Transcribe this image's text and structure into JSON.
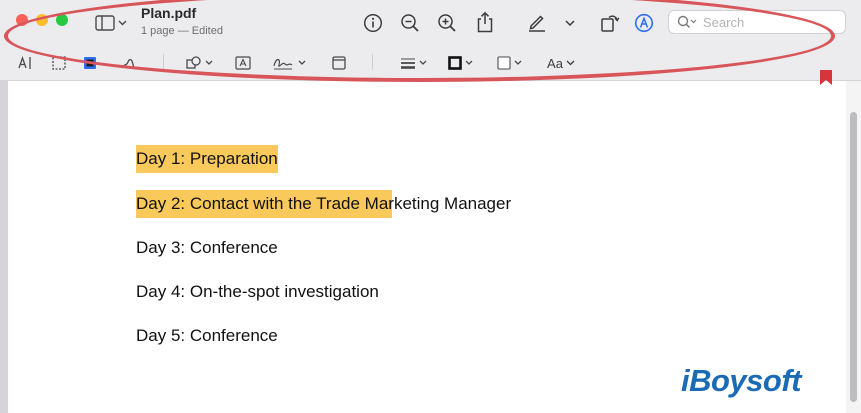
{
  "window": {
    "title": "Plan.pdf",
    "subtitle": "1 page — Edited"
  },
  "toolbar": {
    "icons": [
      "sidebar-icon",
      "info-icon",
      "zoom-out-icon",
      "zoom-in-icon",
      "share-icon",
      "highlight-icon",
      "rotate-icon",
      "markup-icon",
      "search-icon"
    ],
    "search": {
      "placeholder": "Search",
      "value": ""
    }
  },
  "markup_toolbar": {
    "tools": [
      "text-selection-icon",
      "rectangular-selection-icon",
      "sketch-icon",
      "draw-icon",
      "shapes-icon",
      "text-box-icon",
      "sign-icon",
      "note-icon",
      "line-style-icon",
      "border-color-icon",
      "fill-color-icon"
    ],
    "text_style_label": "Aa"
  },
  "document": {
    "lines": [
      {
        "text": "Day 1: Preparation",
        "highlight": "full"
      },
      {
        "text": "Day 2: Contact with the Trade Marketing Manager",
        "highlight": "partial"
      },
      {
        "text": "Day 3: Conference",
        "highlight": "none"
      },
      {
        "text": "Day 4: On-the-spot investigation",
        "highlight": "none"
      },
      {
        "text": "Day 5: Conference",
        "highlight": "none"
      }
    ]
  },
  "watermark": {
    "text": "iBoysoft"
  },
  "colors": {
    "highlight": "#f9c95b",
    "annotation_outline": "#d8565a",
    "markup_accent": "#2e6ff2",
    "watermark": "#1a6ab5"
  }
}
